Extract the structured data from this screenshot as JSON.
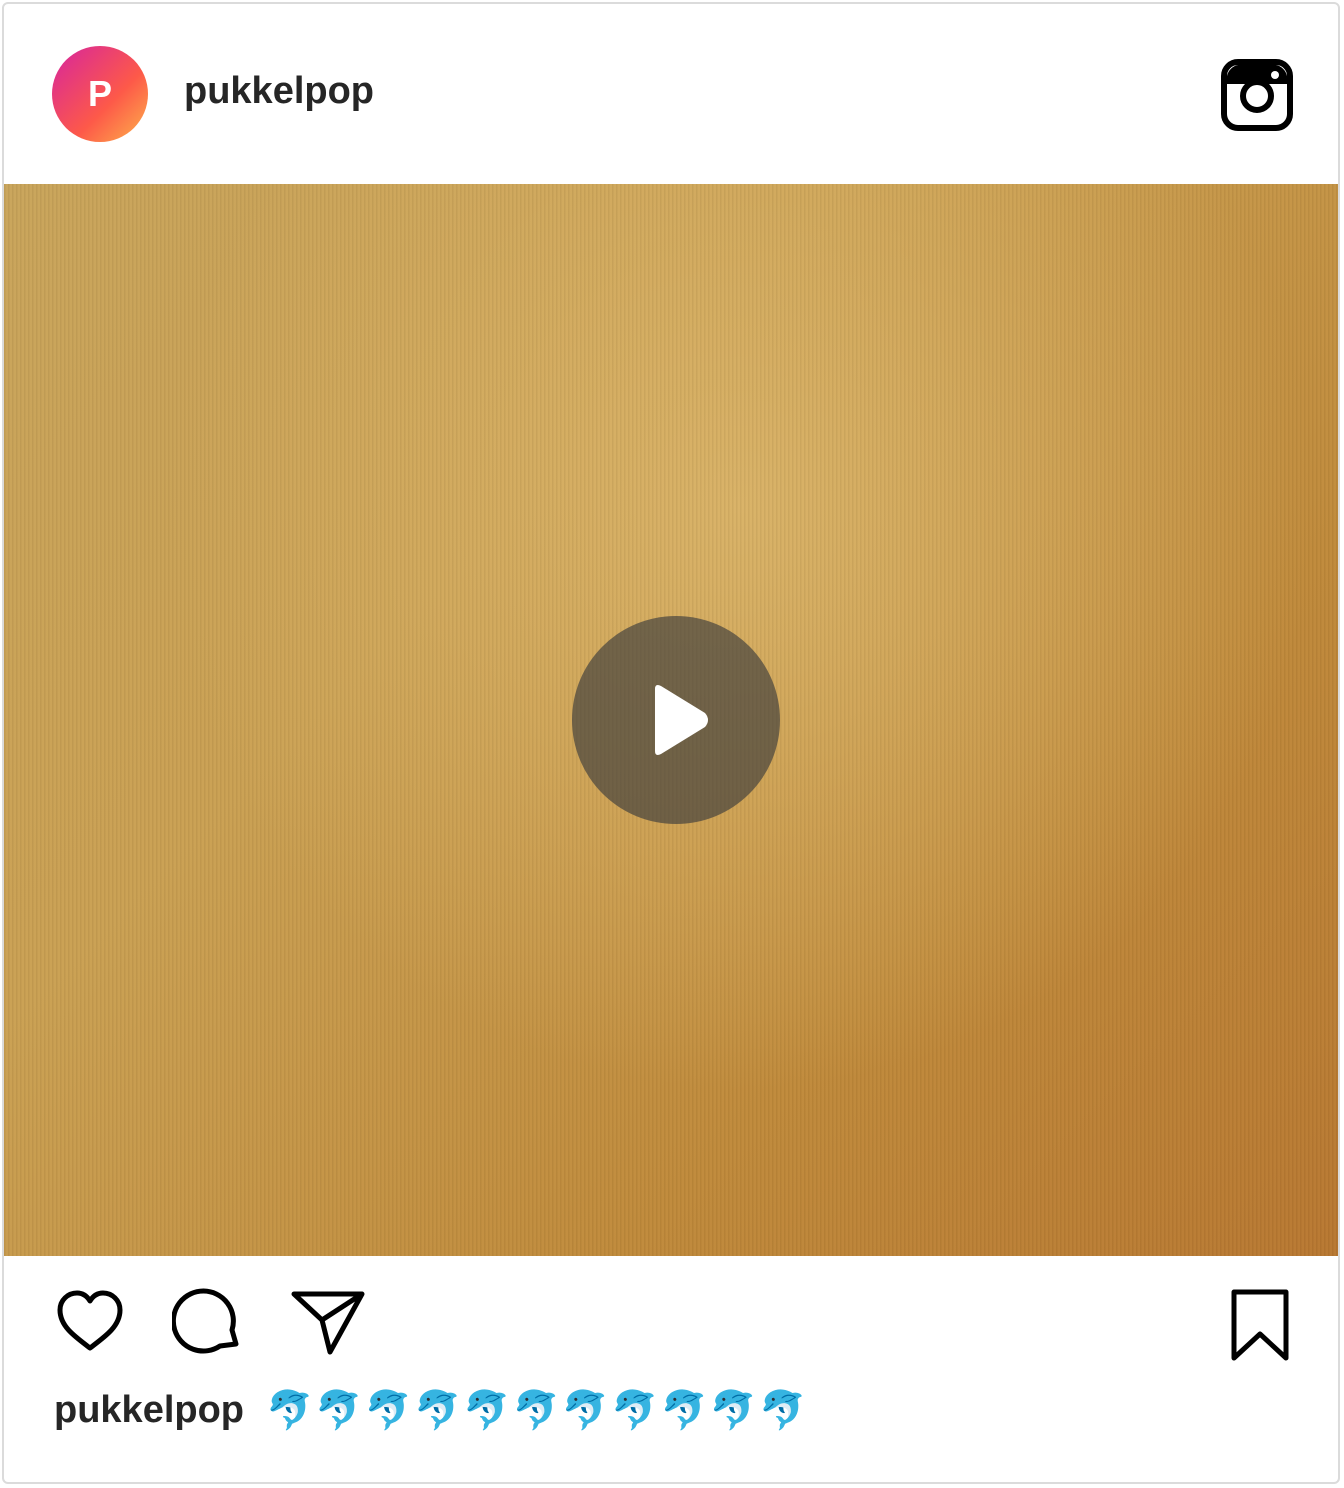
{
  "header": {
    "avatar_letter": "P",
    "username": "pukkelpop",
    "instagram_icon": "instagram-logo-icon"
  },
  "media": {
    "type": "video",
    "play_icon": "play-icon"
  },
  "actions": {
    "like_icon": "heart-icon",
    "comment_icon": "comment-bubble-icon",
    "share_icon": "paper-plane-icon",
    "save_icon": "bookmark-icon"
  },
  "caption": {
    "username": "pukkelpop",
    "text": "🐬🐬🐬🐬🐬🐬🐬🐬🐬🐬🐬"
  },
  "colors": {
    "text": "#262626",
    "border": "#dbdbdb",
    "avatar_gradient_start": "#d6249f",
    "avatar_gradient_end": "#fdb34a"
  }
}
